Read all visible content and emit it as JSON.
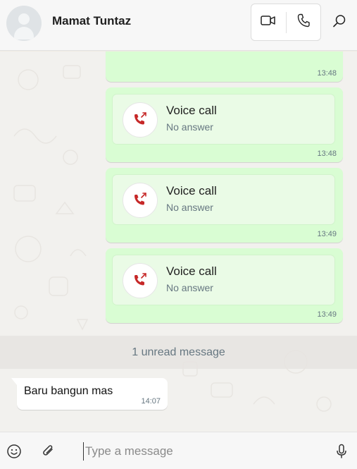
{
  "header": {
    "contact_name": "Mamat Tuntaz",
    "icons": {
      "avatar": "default-avatar",
      "video": "video-camera-icon",
      "voice": "phone-icon",
      "search": "search-icon"
    }
  },
  "messages": {
    "partial_time": "13:48",
    "calls": [
      {
        "title": "Voice call",
        "status": "No answer",
        "time": "13:48"
      },
      {
        "title": "Voice call",
        "status": "No answer",
        "time": "13:49"
      },
      {
        "title": "Voice call",
        "status": "No answer",
        "time": "13:49"
      }
    ],
    "unread_label": "1 unread message",
    "incoming": {
      "text": "Baru bangun mas",
      "time": "14:07"
    }
  },
  "composer": {
    "placeholder": "Type a message",
    "value": "",
    "icons": {
      "emoji": "emoji-icon",
      "attach": "paperclip-icon",
      "mic": "microphone-icon"
    }
  },
  "colors": {
    "outgoing_bubble": "#d9fdd3",
    "call_card": "#eafbe6",
    "missed_call": "#c62828",
    "muted_text": "#667781"
  }
}
